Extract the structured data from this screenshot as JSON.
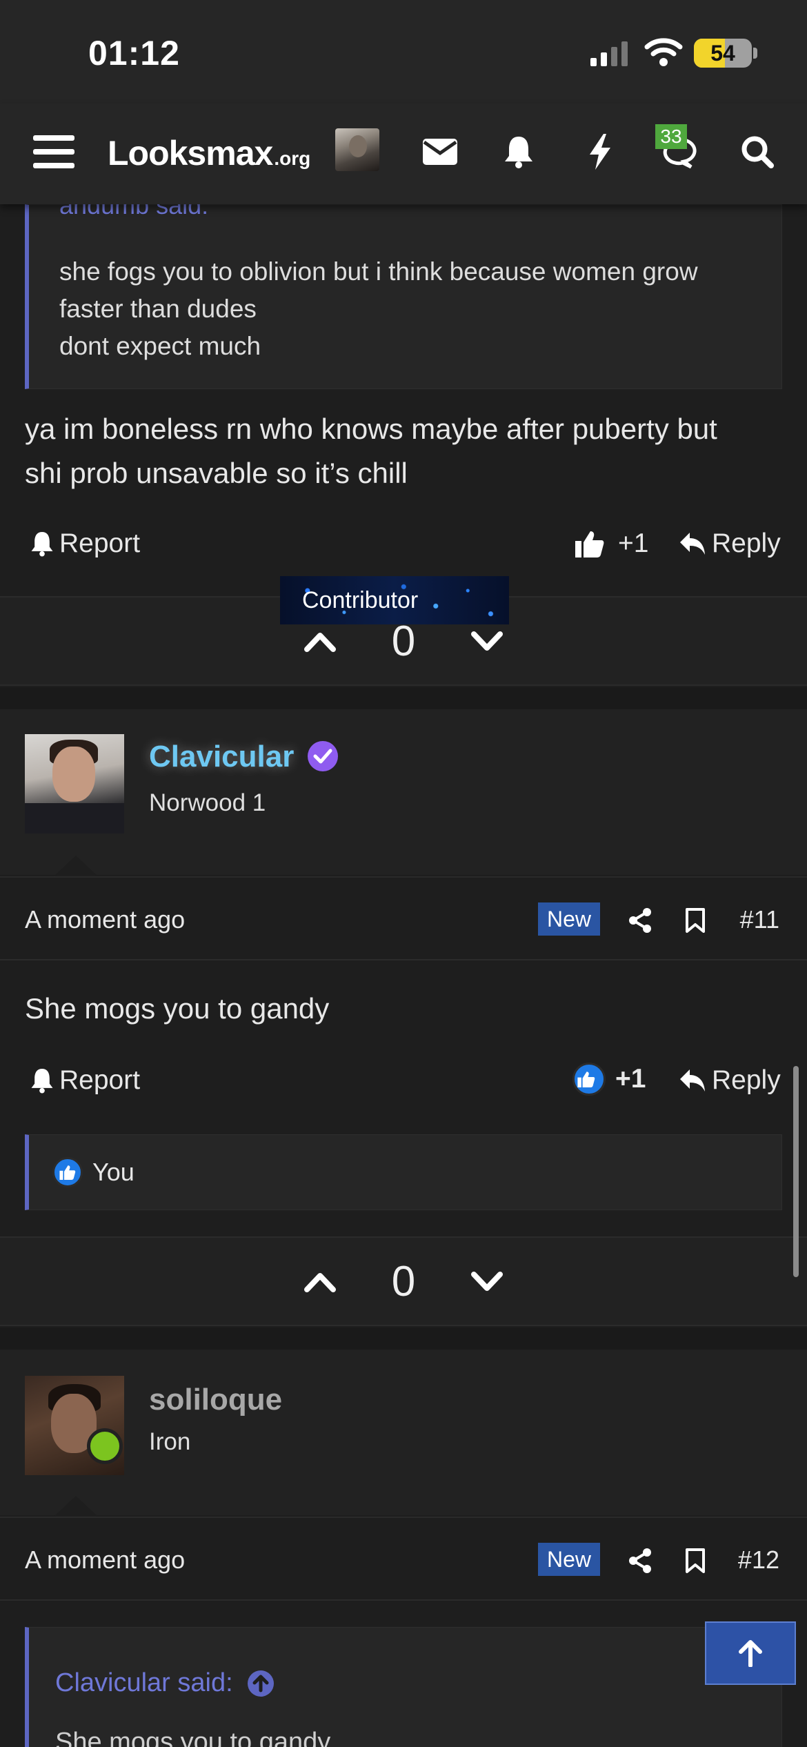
{
  "status_bar": {
    "time": "01:12",
    "battery": "54",
    "battery_level_pct": 54
  },
  "nav": {
    "logo_main": "Looksmax",
    "logo_suffix": ".org",
    "alerts_count": "33"
  },
  "post10": {
    "quote_author_cut": "andumb said:",
    "quote_lines": [
      "she fogs you to oblivion but i think because women grow",
      "faster than dudes",
      "dont expect much"
    ],
    "body_lines": [
      "ya im boneless rn who knows maybe after puberty but",
      "shi prob unsavable so it’s chill"
    ],
    "report_label": "Report",
    "like_count": "+1",
    "reply_label": "Reply",
    "vote_score": "0"
  },
  "post11": {
    "username": "Clavicular",
    "user_title": "Norwood 1",
    "banner": "Contributor",
    "time": "A moment ago",
    "new_badge": "New",
    "number": "#11",
    "body": "She mogs you to gandy",
    "report_label": "Report",
    "like_count": "+1",
    "reply_label": "Reply",
    "reactions": "You",
    "vote_score": "0"
  },
  "post12": {
    "username": "soliloque",
    "user_title": "Iron",
    "time": "A moment ago",
    "new_badge": "New",
    "number": "#12",
    "quote_author": "Clavicular said:",
    "quote_text": "She mogs you to gandy"
  },
  "colors": {
    "accent": "#5d66c2",
    "new_badge": "#2a55a3",
    "online": "#7cc41f",
    "username_highlight": "#6ec8f2"
  }
}
